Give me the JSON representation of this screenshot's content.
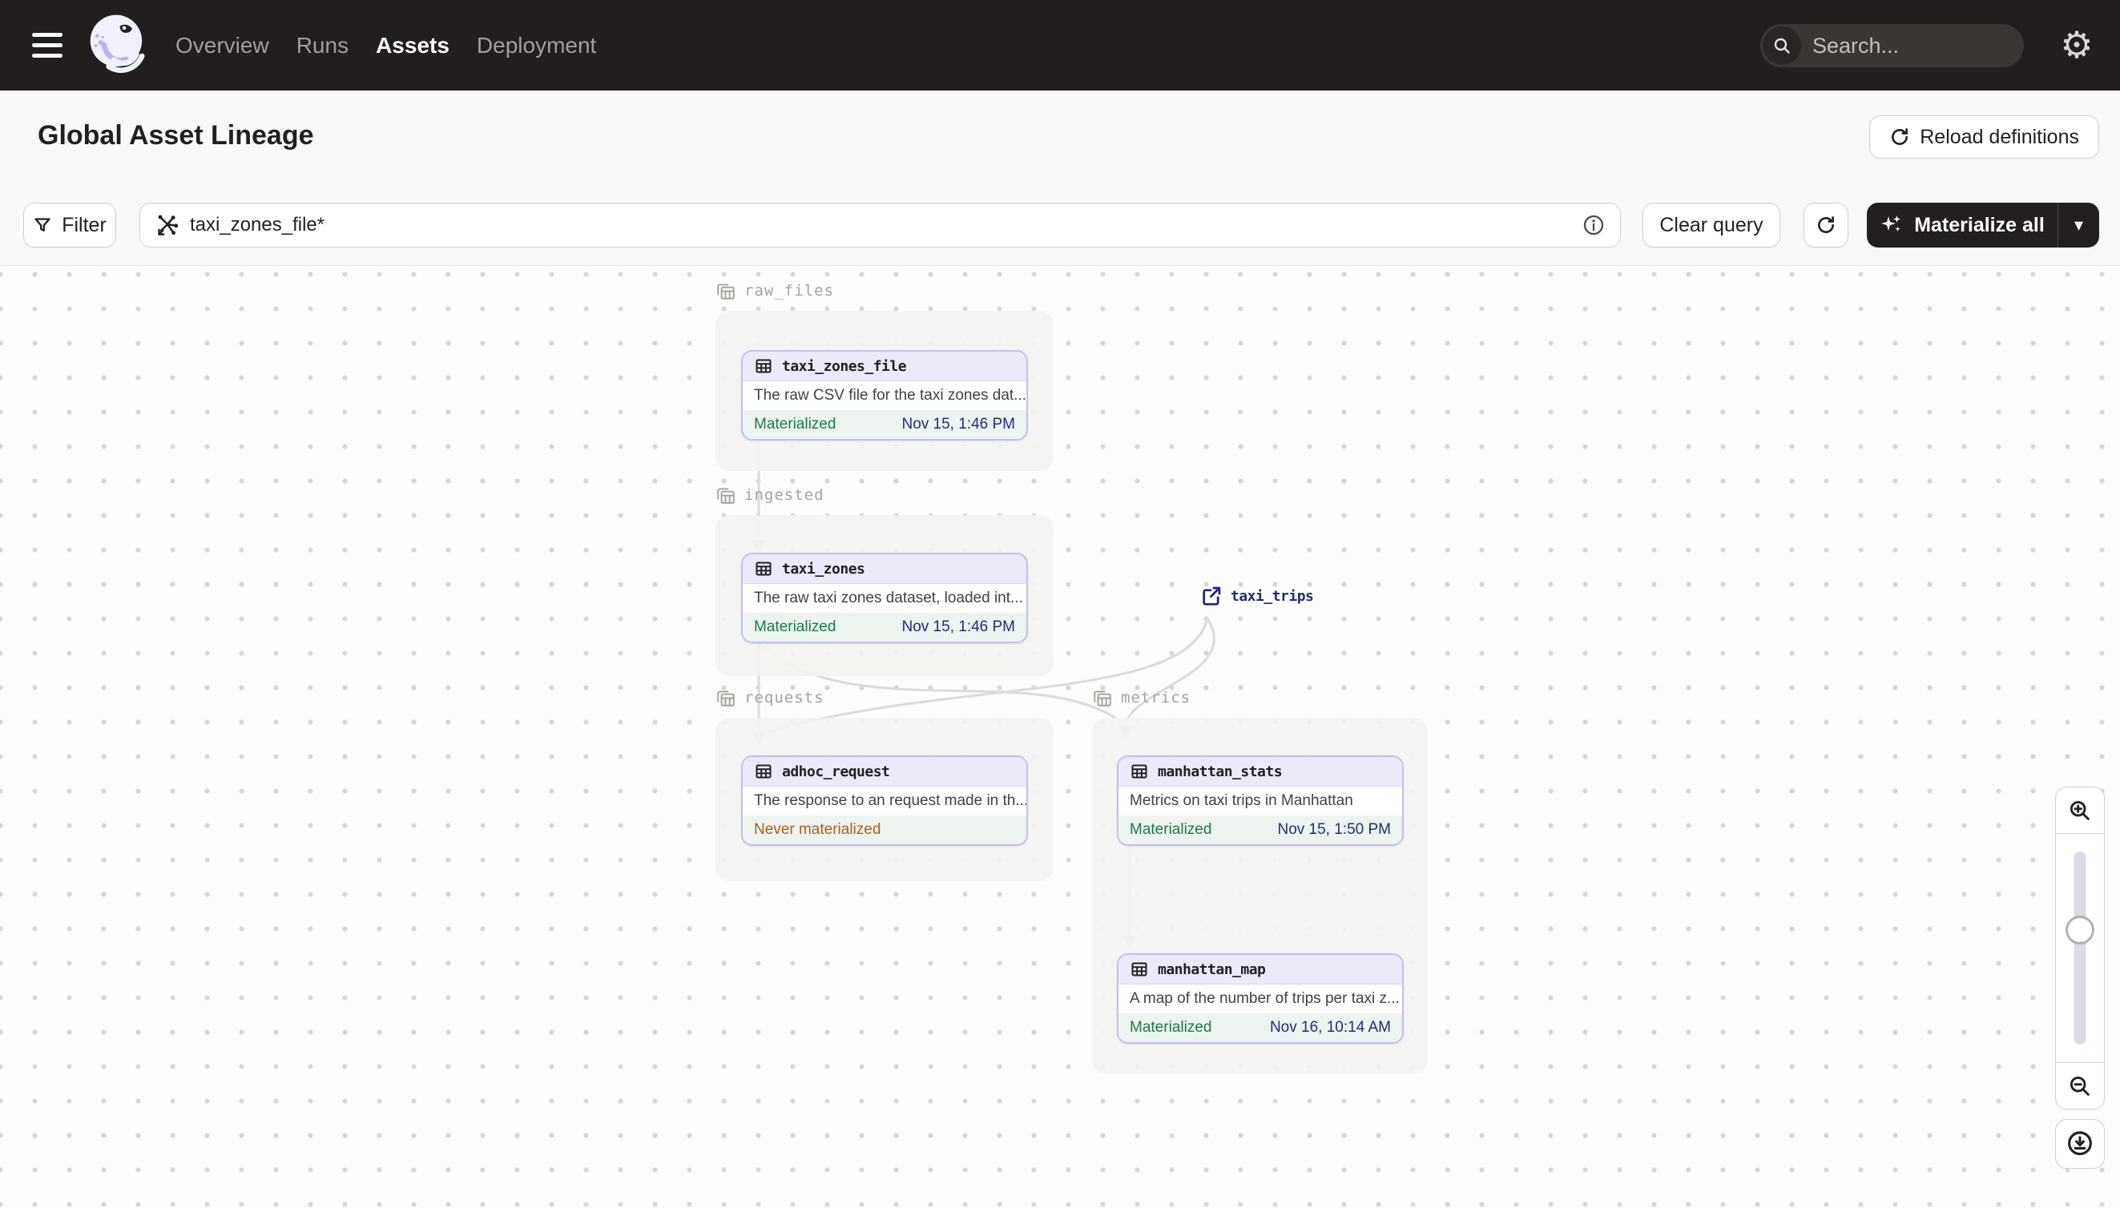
{
  "nav": {
    "items": [
      {
        "label": "Overview",
        "active": false
      },
      {
        "label": "Runs",
        "active": false
      },
      {
        "label": "Assets",
        "active": true
      },
      {
        "label": "Deployment",
        "active": false
      }
    ],
    "search_placeholder": "Search...",
    "search_shortcut": "/"
  },
  "header": {
    "title": "Global Asset Lineage",
    "reload_label": "Reload definitions"
  },
  "toolbar": {
    "filter_label": "Filter",
    "query_value": "taxi_zones_file*",
    "clear_label": "Clear query",
    "materialize_label": "Materialize all"
  },
  "graph": {
    "groups": [
      {
        "name": "raw_files"
      },
      {
        "name": "ingested"
      },
      {
        "name": "requests"
      },
      {
        "name": "metrics"
      }
    ],
    "nodes": [
      {
        "name": "taxi_zones_file",
        "group": "raw_files",
        "description": "The raw CSV file for the taxi zones dat...",
        "status": "Materialized",
        "timestamp": "Nov 15, 1:46 PM"
      },
      {
        "name": "taxi_zones",
        "group": "ingested",
        "description": "The raw taxi zones dataset, loaded int...",
        "status": "Materialized",
        "timestamp": "Nov 15, 1:46 PM"
      },
      {
        "name": "adhoc_request",
        "group": "requests",
        "description": "The response to an request made in th...",
        "status": "Never materialized",
        "timestamp": ""
      },
      {
        "name": "manhattan_stats",
        "group": "metrics",
        "description": "Metrics on taxi trips in Manhattan",
        "status": "Materialized",
        "timestamp": "Nov 15, 1:50 PM"
      },
      {
        "name": "manhattan_map",
        "group": "metrics",
        "description": "A map of the number of trips per taxi z...",
        "status": "Materialized",
        "timestamp": "Nov 16, 10:14 AM"
      }
    ],
    "external_asset": {
      "name": "taxi_trips"
    }
  },
  "icons": {
    "gear": "⚙",
    "caret_down": "▾"
  },
  "colors": {
    "nav_background": "#211E1D",
    "chrome_background": "#FAF9F8",
    "canvas_background": "#FDFDFB",
    "node_border_lavender": "#C4BFF1",
    "node_header_lavender": "#ECEAF9",
    "footer_mint": "#EDF3EE",
    "materialized_green": "#1B7B4D",
    "never_materialized_orange": "#AD5F17",
    "timestamp_navy": "#232B7E",
    "edge_gray": "#DDDAD7",
    "group_gray": "#F3F2F0"
  }
}
